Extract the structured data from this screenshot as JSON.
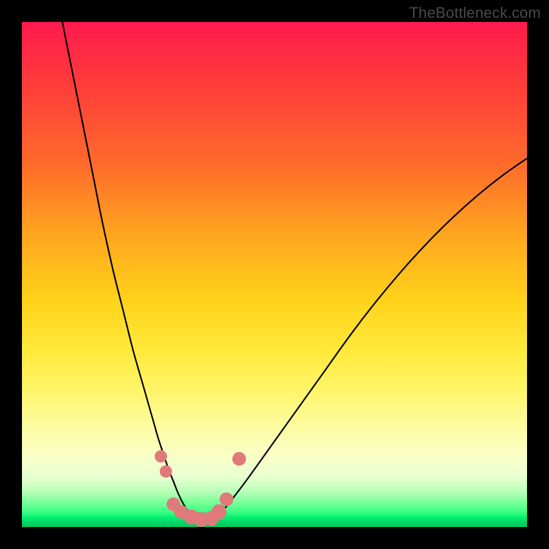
{
  "watermark": "TheBottleneck.com",
  "chart_data": {
    "type": "line",
    "title": "",
    "xlabel": "",
    "ylabel": "",
    "xlim": [
      0,
      100
    ],
    "ylim": [
      0,
      100
    ],
    "grid": false,
    "series": [
      {
        "name": "left-curve",
        "x": [
          8,
          10,
          12,
          14,
          16,
          18,
          20,
          22,
          24,
          26,
          27,
          28,
          29,
          30,
          31,
          32,
          33,
          34,
          35,
          36
        ],
        "y": [
          100,
          90,
          80,
          70,
          60,
          51,
          43,
          35,
          28,
          21,
          17.5,
          14.5,
          11.5,
          9,
          6.5,
          4.5,
          3,
          2,
          1.3,
          1
        ]
      },
      {
        "name": "right-curve",
        "x": [
          36,
          37,
          38,
          39,
          40,
          42,
          45,
          50,
          55,
          60,
          65,
          70,
          75,
          80,
          85,
          90,
          95,
          100
        ],
        "y": [
          1,
          1.1,
          1.5,
          2.3,
          3.5,
          6,
          10,
          17,
          24,
          31,
          38,
          44.5,
          50.5,
          56,
          61,
          65.5,
          69.5,
          73
        ]
      }
    ],
    "markers": {
      "name": "bottom-markers",
      "color": "#e07a7a",
      "points": [
        {
          "x": 27.5,
          "y": 14,
          "r": 9
        },
        {
          "x": 28.5,
          "y": 11,
          "r": 9
        },
        {
          "x": 30.0,
          "y": 4.5,
          "r": 10
        },
        {
          "x": 31.5,
          "y": 3.0,
          "r": 10
        },
        {
          "x": 33.5,
          "y": 2.0,
          "r": 11
        },
        {
          "x": 35.5,
          "y": 1.5,
          "r": 11
        },
        {
          "x": 37.5,
          "y": 1.7,
          "r": 11
        },
        {
          "x": 39.0,
          "y": 3.0,
          "r": 11
        },
        {
          "x": 40.5,
          "y": 5.5,
          "r": 10
        },
        {
          "x": 43.0,
          "y": 13.5,
          "r": 10
        }
      ]
    },
    "background_gradient": {
      "top": "#ff1a4d",
      "mid": "#ffe93a",
      "bottom": "#00d868"
    }
  }
}
